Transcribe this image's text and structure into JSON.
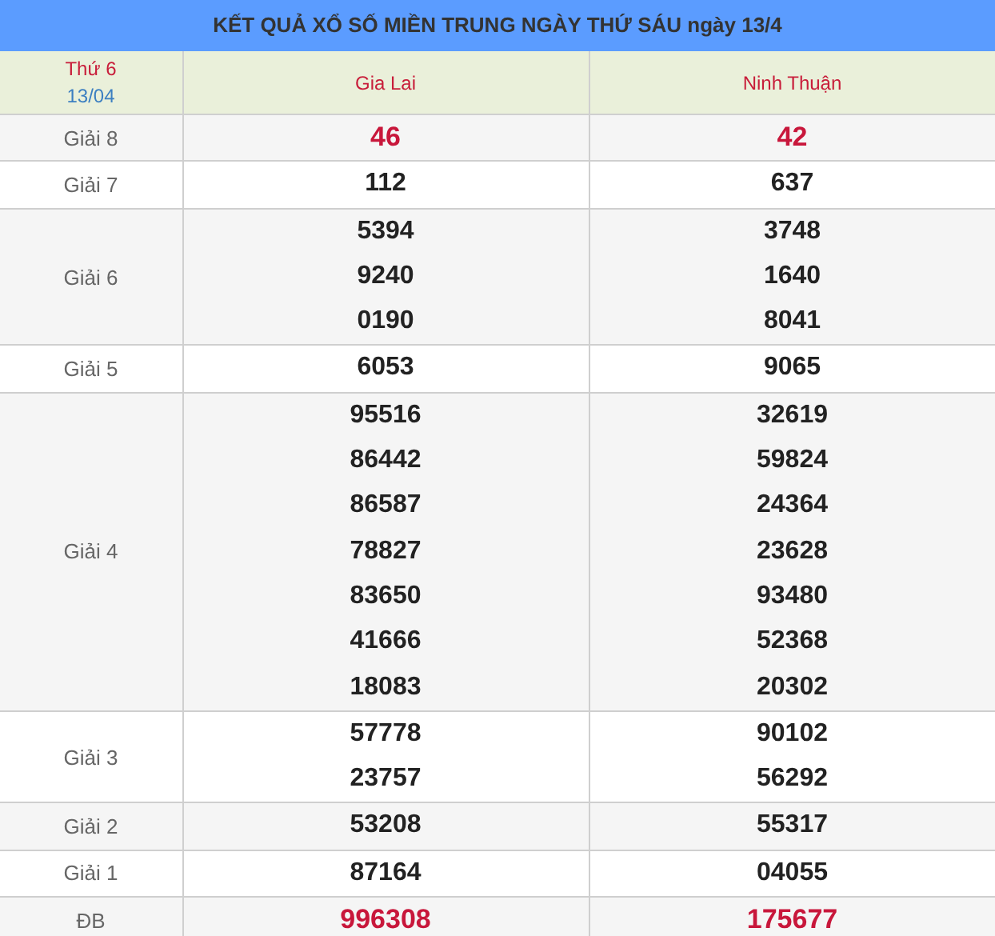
{
  "title": "KẾT QUẢ XỔ SỐ MIỀN TRUNG NGÀY THỨ SÁU ngày 13/4",
  "header": {
    "weekday": "Thứ 6",
    "date": "13/04"
  },
  "provinces": [
    "Gia Lai",
    "Ninh Thuận"
  ],
  "prizes": [
    {
      "label": "Giải 8",
      "highlight": true,
      "results": [
        [
          "46"
        ],
        [
          "42"
        ]
      ]
    },
    {
      "label": "Giải 7",
      "highlight": false,
      "results": [
        [
          "112"
        ],
        [
          "637"
        ]
      ]
    },
    {
      "label": "Giải 6",
      "highlight": false,
      "results": [
        [
          "5394",
          "9240",
          "0190"
        ],
        [
          "3748",
          "1640",
          "8041"
        ]
      ]
    },
    {
      "label": "Giải 5",
      "highlight": false,
      "results": [
        [
          "6053"
        ],
        [
          "9065"
        ]
      ]
    },
    {
      "label": "Giải 4",
      "highlight": false,
      "results": [
        [
          "95516",
          "86442",
          "86587",
          "78827",
          "83650",
          "41666",
          "18083"
        ],
        [
          "32619",
          "59824",
          "24364",
          "23628",
          "93480",
          "52368",
          "20302"
        ]
      ]
    },
    {
      "label": "Giải 3",
      "highlight": false,
      "results": [
        [
          "57778",
          "23757"
        ],
        [
          "90102",
          "56292"
        ]
      ]
    },
    {
      "label": "Giải 2",
      "highlight": false,
      "results": [
        [
          "53208"
        ],
        [
          "55317"
        ]
      ]
    },
    {
      "label": "Giải 1",
      "highlight": false,
      "results": [
        [
          "87164"
        ],
        [
          "04055"
        ]
      ]
    },
    {
      "label": "ĐB",
      "highlight": true,
      "results": [
        [
          "996308"
        ],
        [
          "175677"
        ]
      ]
    }
  ]
}
